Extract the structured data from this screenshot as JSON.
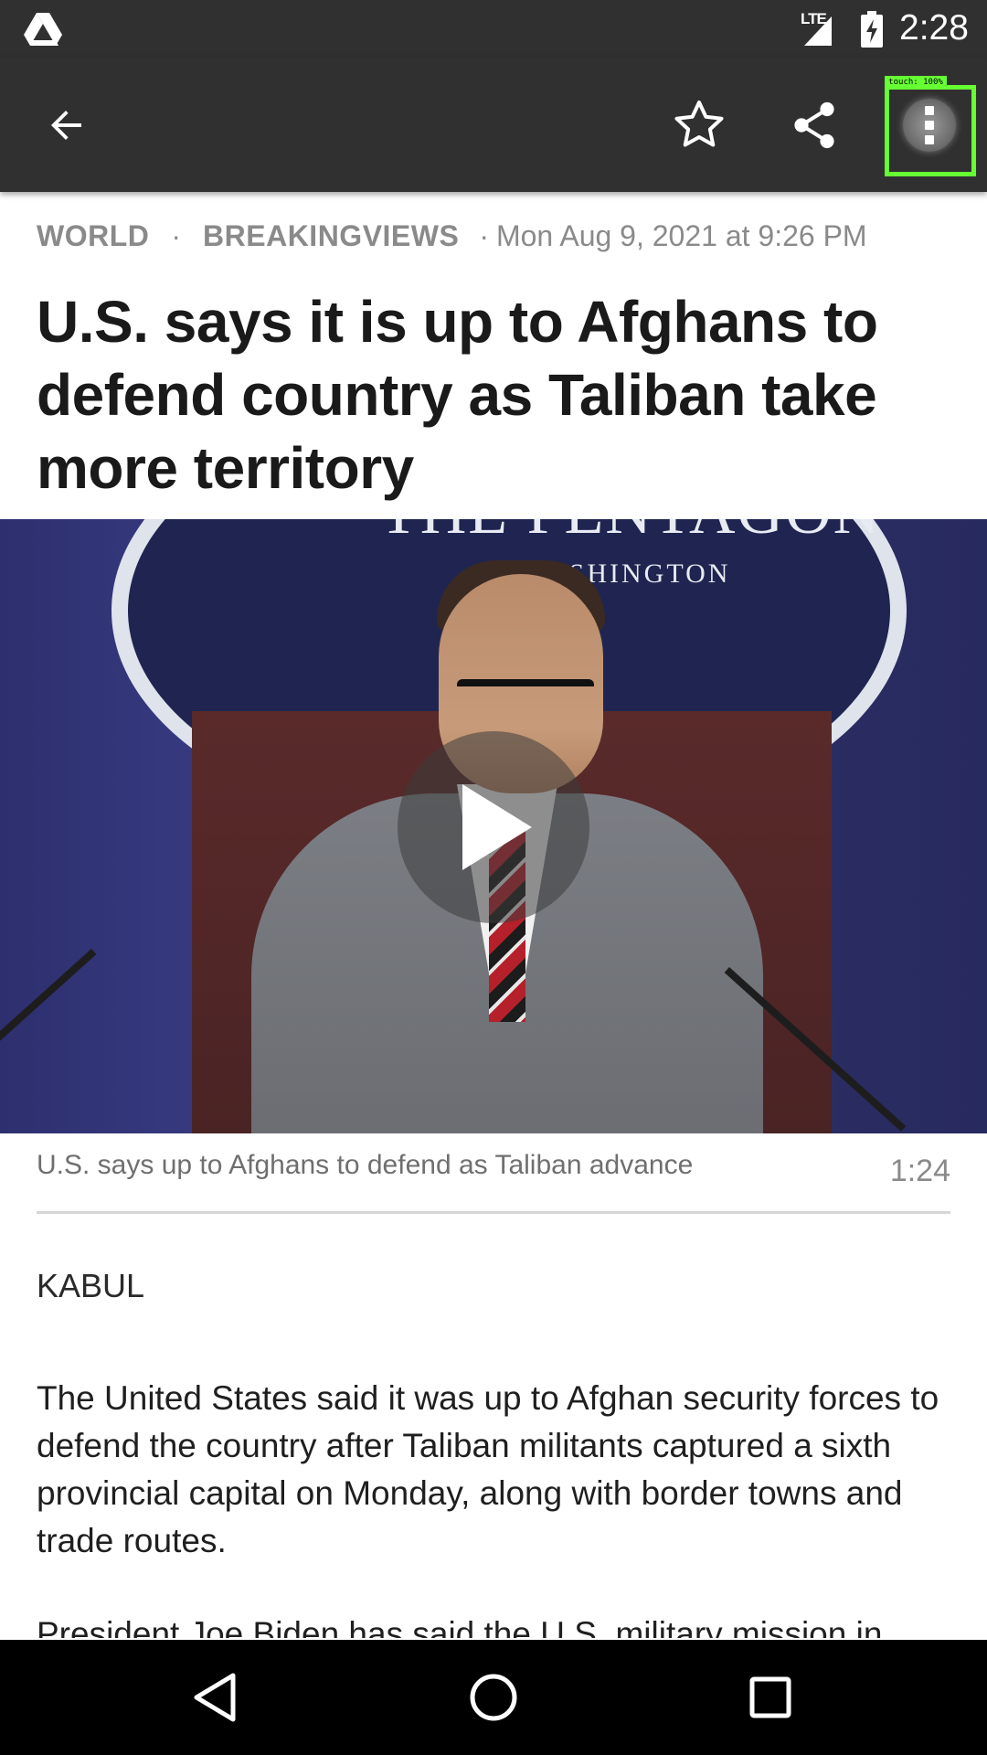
{
  "status_bar": {
    "network": "LTE",
    "time": "2:28"
  },
  "app_bar": {
    "touch_label": "touch: 100%"
  },
  "article": {
    "category": "WORLD",
    "section": "BREAKINGVIEWS",
    "separator": "·",
    "timestamp": "Mon Aug 9, 2021 at 9:26 PM",
    "headline": "U.S. says it is up to Afghans to defend country as Taliban take more territory",
    "video": {
      "seal_text": "THE PENTAGON",
      "seal_subtext": "WASHINGTON",
      "caption": "U.S. says up to Afghans to defend as Taliban advance",
      "duration": "1:24"
    },
    "dateline": "KABUL",
    "paragraphs": [
      "The United States said it was up to Afghan security forces to defend the country after Taliban militants captured a sixth provincial capital on Monday, along with border towns and trade routes.",
      "President Joe Biden has said the U.S. military mission in"
    ]
  },
  "colors": {
    "app_bar": "#303030",
    "status_bar": "#303030",
    "nav_bar": "#000000",
    "touch_highlight": "#66ff33",
    "meta_text": "#8a8a8a",
    "headline_text": "#1a1a1a"
  },
  "icons": {
    "back": "arrow-left-icon",
    "star": "star-outline-icon",
    "share": "share-icon",
    "more": "more-vert-icon",
    "play": "play-icon"
  }
}
